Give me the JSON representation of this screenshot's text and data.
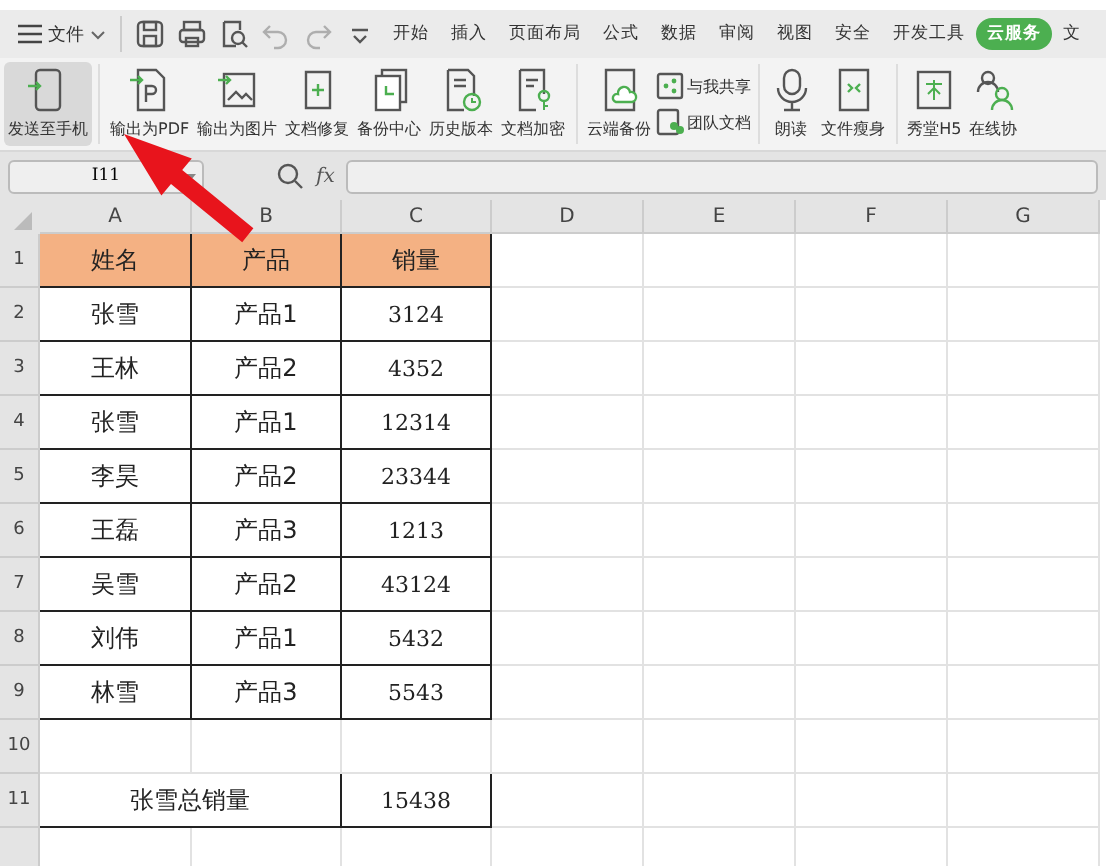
{
  "menu_bar": {
    "file_menu": "文件",
    "quick_tools": [
      {
        "kind": "save",
        "disabled": false
      },
      {
        "kind": "print",
        "disabled": false
      },
      {
        "kind": "preview",
        "disabled": false
      },
      {
        "kind": "undo",
        "disabled": true
      },
      {
        "kind": "redo",
        "disabled": true
      },
      {
        "kind": "more",
        "disabled": false
      }
    ],
    "tabs": [
      {
        "label": "开始",
        "selected": false
      },
      {
        "label": "插入",
        "selected": false
      },
      {
        "label": "页面布局",
        "selected": false
      },
      {
        "label": "公式",
        "selected": false
      },
      {
        "label": "数据",
        "selected": false
      },
      {
        "label": "审阅",
        "selected": false
      },
      {
        "label": "视图",
        "selected": false
      },
      {
        "label": "安全",
        "selected": false
      },
      {
        "label": "开发工具",
        "selected": false
      },
      {
        "label": "云服务",
        "selected": true
      },
      {
        "label": "文",
        "selected": false
      }
    ]
  },
  "ribbon": {
    "groups": [
      [
        {
          "label": "发送至手机",
          "kind": "large",
          "selected": true
        }
      ],
      [
        {
          "label": "输出为PDF",
          "kind": "large",
          "selected": false
        },
        {
          "label": "输出为图片",
          "kind": "large",
          "selected": false
        },
        {
          "label": "文档修复",
          "kind": "large",
          "selected": false
        },
        {
          "label": "备份中心",
          "kind": "large",
          "selected": false
        },
        {
          "label": "历史版本",
          "kind": "large",
          "selected": false
        },
        {
          "label": "文档加密",
          "kind": "large",
          "selected": false
        }
      ],
      [
        {
          "label": "云端备份",
          "kind": "large",
          "selected": false
        },
        {
          "label": "与我共享",
          "kind": "small",
          "selected": false
        },
        {
          "label": "团队文档",
          "kind": "small",
          "selected": false
        }
      ],
      [
        {
          "label": "朗读",
          "kind": "large",
          "selected": false
        },
        {
          "label": "文件瘦身",
          "kind": "large",
          "selected": false
        }
      ],
      [
        {
          "label": "秀堂H5",
          "kind": "large",
          "selected": false
        },
        {
          "label": "在线协",
          "kind": "large",
          "selected": false
        }
      ]
    ]
  },
  "formula_bar": {
    "name_box": "I11",
    "fx": "fx"
  },
  "sheet": {
    "columns": [
      "A",
      "B",
      "C",
      "D",
      "E",
      "F",
      "G"
    ],
    "rows": [
      {
        "number": "1",
        "kind": "header",
        "cells": [
          "姓名",
          "产品",
          "销量"
        ]
      },
      {
        "number": "2",
        "kind": "data",
        "cells": [
          "张雪",
          "产品1",
          "3124"
        ]
      },
      {
        "number": "3",
        "kind": "data",
        "cells": [
          "王林",
          "产品2",
          "4352"
        ]
      },
      {
        "number": "4",
        "kind": "data",
        "cells": [
          "张雪",
          "产品1",
          "12314"
        ]
      },
      {
        "number": "5",
        "kind": "data",
        "cells": [
          "李昊",
          "产品2",
          "23344"
        ]
      },
      {
        "number": "6",
        "kind": "data",
        "cells": [
          "王磊",
          "产品3",
          "1213"
        ]
      },
      {
        "number": "7",
        "kind": "data",
        "cells": [
          "吴雪",
          "产品2",
          "43124"
        ]
      },
      {
        "number": "8",
        "kind": "data",
        "cells": [
          "刘伟",
          "产品1",
          "5432"
        ]
      },
      {
        "number": "9",
        "kind": "data",
        "cells": [
          "林雪",
          "产品3",
          "5543"
        ]
      },
      {
        "number": "10",
        "kind": "empty",
        "cells": []
      },
      {
        "number": "11",
        "kind": "total",
        "cells": [
          "张雪总销量",
          "",
          "15438"
        ]
      }
    ]
  },
  "annotation": {
    "kind": "arrow"
  }
}
